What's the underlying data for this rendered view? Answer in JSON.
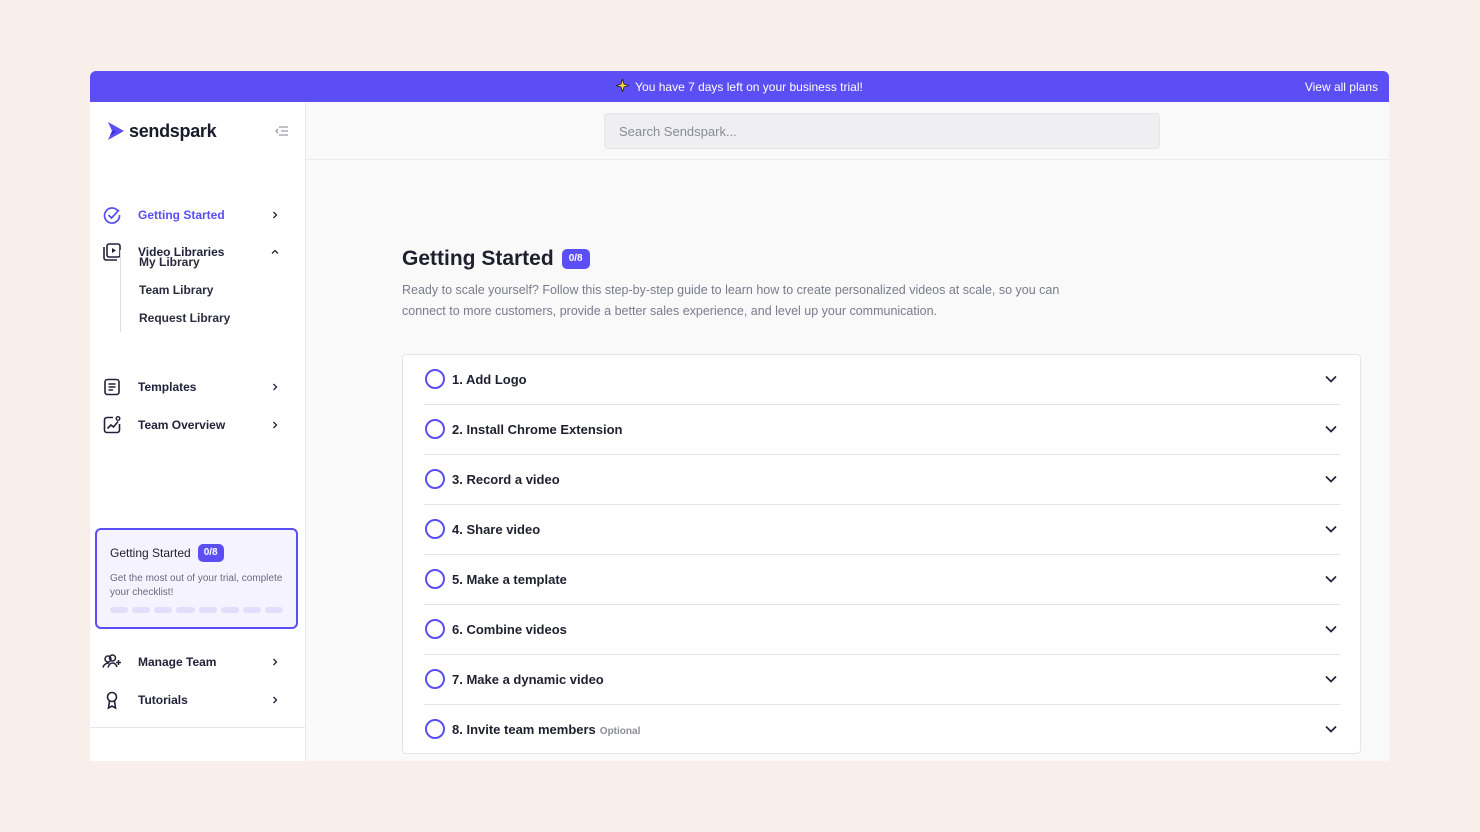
{
  "banner": {
    "message": "You have 7 days left on your business trial!",
    "link": "View all plans",
    "icon": "sparkle-icon"
  },
  "brand": {
    "name": "sendspark",
    "color": "#5b4ef5"
  },
  "sidebar": {
    "items": [
      {
        "label": "Getting Started",
        "icon": "check-circle-icon"
      },
      {
        "label": "Video Libraries",
        "icon": "video-library-icon"
      },
      {
        "label": "Templates",
        "icon": "template-icon"
      },
      {
        "label": "Team Overview",
        "icon": "chart-icon"
      }
    ],
    "subitems": [
      "My Library",
      "Team Library",
      "Request Library"
    ],
    "bottom_items": [
      {
        "label": "Manage Team",
        "icon": "add-user-icon"
      },
      {
        "label": "Tutorials",
        "icon": "award-icon"
      }
    ]
  },
  "progress_card": {
    "title": "Getting Started",
    "badge": "0/8",
    "description": "Get the most out of your trial, complete your checklist!",
    "completed": 0,
    "total": 8
  },
  "search": {
    "placeholder": "Search Sendspark..."
  },
  "main": {
    "title": "Getting Started",
    "badge": "0/8",
    "description": "Ready to scale yourself? Follow this step-by-step guide to learn how to create personalized videos at scale, so you can connect to more customers, provide a better sales experience, and level up your communication.",
    "steps": [
      {
        "label": "1. Add Logo",
        "optional": ""
      },
      {
        "label": "2. Install Chrome Extension",
        "optional": ""
      },
      {
        "label": "3. Record a video",
        "optional": ""
      },
      {
        "label": "4. Share video",
        "optional": ""
      },
      {
        "label": "5. Make a template",
        "optional": ""
      },
      {
        "label": "6. Combine videos",
        "optional": ""
      },
      {
        "label": "7. Make a dynamic video",
        "optional": ""
      },
      {
        "label": "8. Invite team members",
        "optional": "Optional"
      }
    ]
  }
}
